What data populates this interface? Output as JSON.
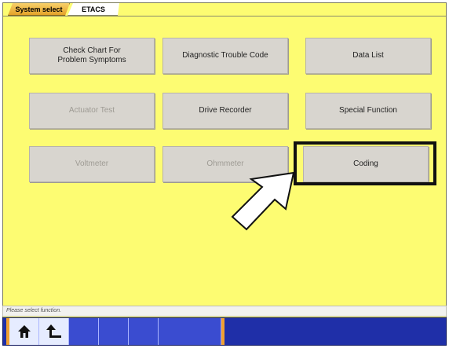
{
  "tabs": [
    {
      "label": "System select"
    },
    {
      "label": "ETACS"
    }
  ],
  "buttons": [
    {
      "label": "Check Chart For\nProblem Symptoms",
      "enabled": true
    },
    {
      "label": "Diagnostic Trouble Code",
      "enabled": true
    },
    {
      "label": "Data List",
      "enabled": true
    },
    {
      "label": "Actuator Test",
      "enabled": false
    },
    {
      "label": "Drive Recorder",
      "enabled": true
    },
    {
      "label": "Special Function",
      "enabled": true
    },
    {
      "label": "Voltmeter",
      "enabled": false
    },
    {
      "label": "Ohmmeter",
      "enabled": false
    },
    {
      "label": "Coding",
      "enabled": true
    }
  ],
  "status": {
    "text": "Please select function."
  },
  "taskbar": {
    "icons": [
      "home-icon",
      "return-icon"
    ]
  },
  "colors": {
    "background": "#fdfc72",
    "button": "#d8d5cf",
    "taskbar": "#1f2fa8",
    "accent": "#f0a030"
  }
}
